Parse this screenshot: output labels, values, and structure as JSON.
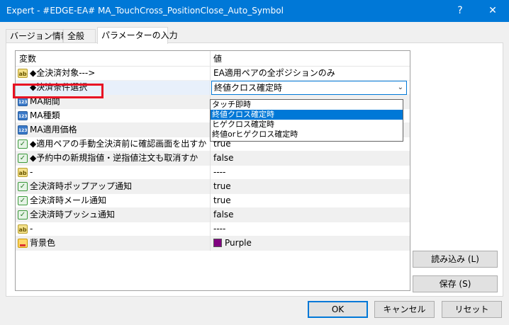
{
  "window": {
    "title": "Expert - #EDGE-EA# MA_TouchCross_PositionClose_Auto_Symbol",
    "help_label": "?",
    "close_label": "✕"
  },
  "tabs": [
    {
      "label": "バージョン情報"
    },
    {
      "label": "全般"
    },
    {
      "label": "パラメーターの入力"
    }
  ],
  "grid": {
    "header": {
      "name": "変数",
      "value": "値"
    },
    "rows": [
      {
        "icon": "ab",
        "name": "◆全決済対象--->",
        "value": "EA適用ペアの全ポジションのみ"
      },
      {
        "icon": "123",
        "name": "◆決済条件選択",
        "value": "終値クロス確定時"
      },
      {
        "icon": "123",
        "name": "MA期間",
        "value": ""
      },
      {
        "icon": "123",
        "name": "MA種類",
        "value": ""
      },
      {
        "icon": "123",
        "name": "MA適用価格",
        "value": ""
      },
      {
        "icon": "bool",
        "name": "◆適用ペアの手動全決済前に確認画面を出すか",
        "value": "true"
      },
      {
        "icon": "bool",
        "name": "◆予約中の新規指値・逆指値注文も取消すか",
        "value": "false"
      },
      {
        "icon": "ab",
        "name": "-",
        "value": "----"
      },
      {
        "icon": "bool",
        "name": "全決済時ポップアップ通知",
        "value": "true"
      },
      {
        "icon": "bool",
        "name": "全決済時メール通知",
        "value": "true"
      },
      {
        "icon": "bool",
        "name": "全決済時プッシュ通知",
        "value": "false"
      },
      {
        "icon": "ab",
        "name": "-",
        "value": "----"
      },
      {
        "icon": "color",
        "name": "背景色",
        "value": "Purple"
      }
    ]
  },
  "dropdown": {
    "options": [
      "タッチ即時",
      "終値クロス確定時",
      "ヒゲクロス確定時",
      "終値orヒゲクロス確定時"
    ],
    "selected_index": 1
  },
  "colors": {
    "background_swatch": "#800080",
    "accent": "#0078d7",
    "highlight_box": "#e81123"
  },
  "buttons": {
    "load": "読み込み (L)",
    "save": "保存 (S)",
    "ok": "OK",
    "cancel": "キャンセル",
    "reset": "リセット"
  }
}
